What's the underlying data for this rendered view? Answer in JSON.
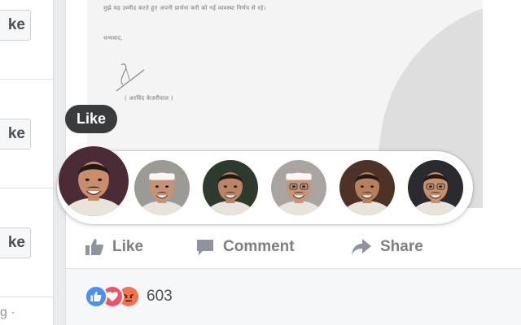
{
  "left_sidebar": {
    "like_buttons": [
      "ke",
      "ke",
      "ke"
    ],
    "footer_fragment": "g ·"
  },
  "post": {
    "document": {
      "line1": "मुझे यह उम्मीद करते हुए अपनी प्रार्थना करी को नई व्यवस्था निर्णय से रहे।",
      "line2": "धन्यवाद,",
      "signature": "( अरविंद केजरीवाल )"
    },
    "tooltip": "Like",
    "actions": {
      "like": "Like",
      "comment": "Comment",
      "share": "Share"
    },
    "reactions": {
      "icons": [
        "like-reaction-icon",
        "love-reaction-icon",
        "angry-reaction-icon"
      ],
      "count": "603",
      "colors": {
        "like": "#4a8ff5",
        "love": "#f25268",
        "angry": "#f7714b"
      }
    }
  },
  "reaction_faces": [
    {
      "name": "reaction-face-1",
      "skin": "#c98d6a",
      "bg": "#4b2b36",
      "cap": false,
      "glasses": false
    },
    {
      "name": "reaction-face-2",
      "skin": "#c89277",
      "bg": "#9c9a96",
      "cap": true,
      "glasses": false
    },
    {
      "name": "reaction-face-3",
      "skin": "#b98566",
      "bg": "#2f3a2e",
      "cap": false,
      "glasses": false
    },
    {
      "name": "reaction-face-4",
      "skin": "#c99376",
      "bg": "#a9a4a0",
      "cap": true,
      "glasses": true
    },
    {
      "name": "reaction-face-5",
      "skin": "#b7805d",
      "bg": "#4d3326",
      "cap": false,
      "glasses": false
    },
    {
      "name": "reaction-face-6",
      "skin": "#c8906a",
      "bg": "#2b2b2f",
      "cap": false,
      "glasses": true
    }
  ]
}
